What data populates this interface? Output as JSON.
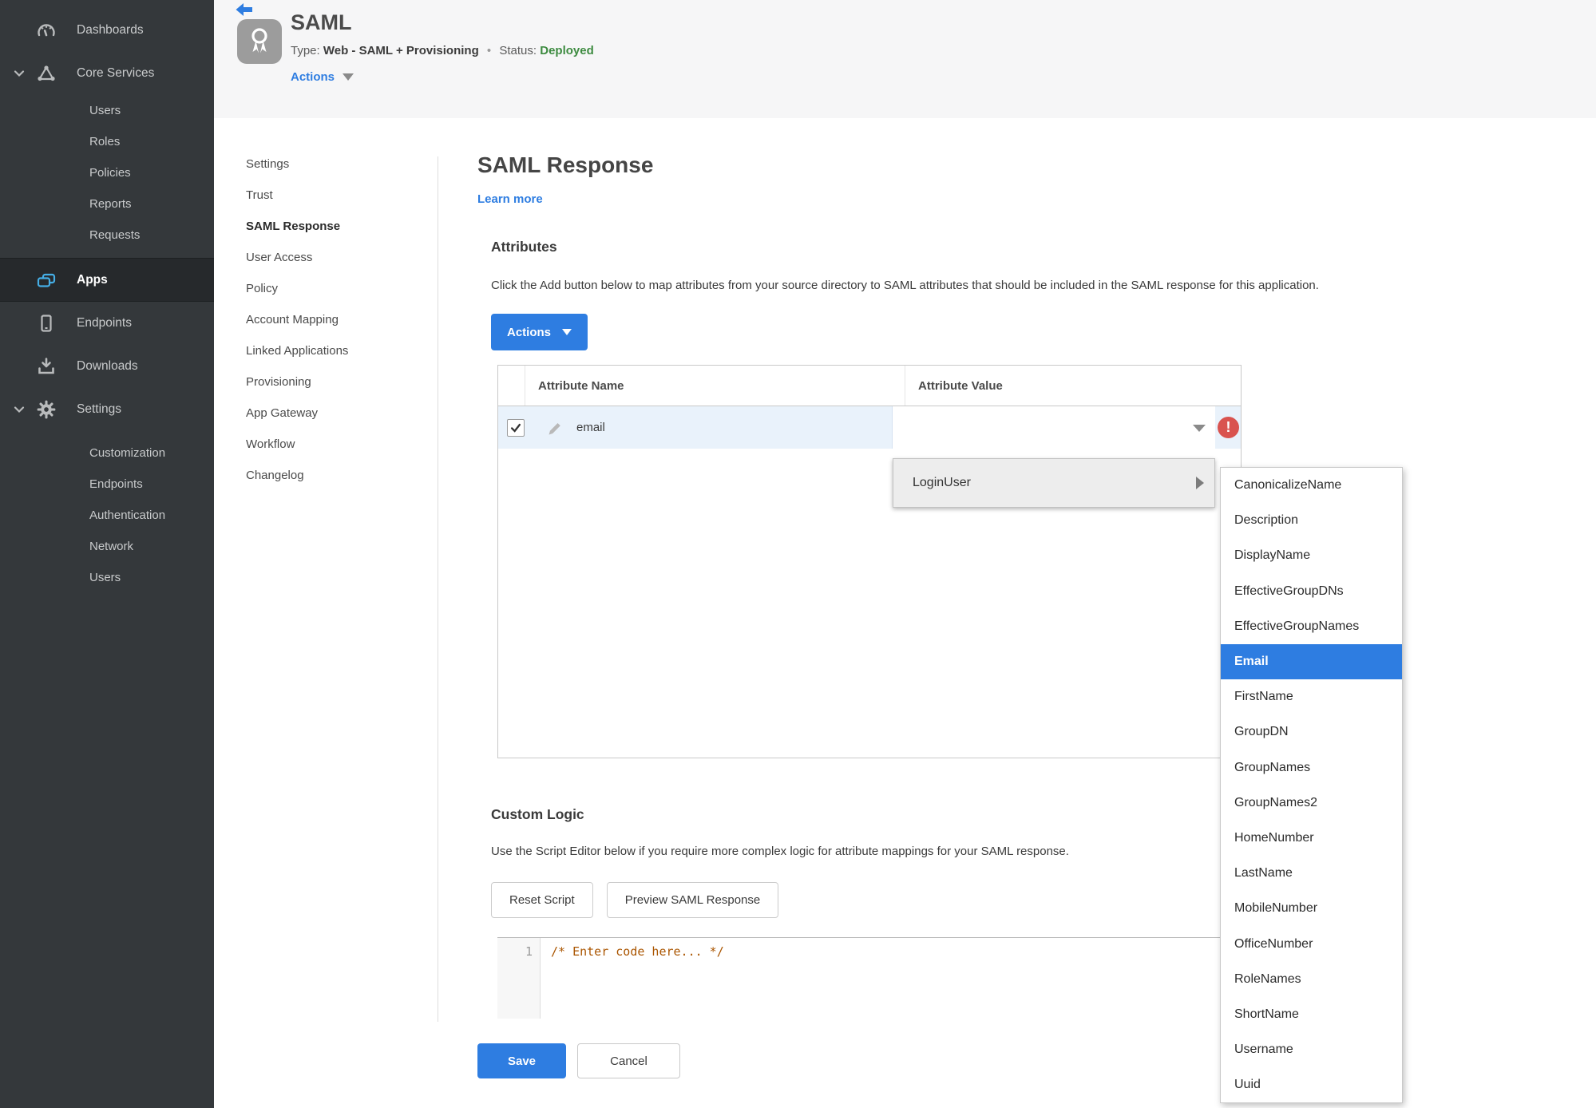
{
  "sidebar": {
    "items": [
      {
        "label": "Dashboards"
      },
      {
        "label": "Core Services"
      },
      {
        "label": "Users"
      },
      {
        "label": "Roles"
      },
      {
        "label": "Policies"
      },
      {
        "label": "Reports"
      },
      {
        "label": "Requests"
      },
      {
        "label": "Apps"
      },
      {
        "label": "Endpoints"
      },
      {
        "label": "Downloads"
      },
      {
        "label": "Settings"
      },
      {
        "label": "Customization"
      },
      {
        "label": "Endpoints"
      },
      {
        "label": "Authentication"
      },
      {
        "label": "Network"
      },
      {
        "label": "Users"
      }
    ],
    "active_item": "Apps"
  },
  "header": {
    "title": "SAML",
    "type_label": "Type:",
    "type_value": "Web - SAML + Provisioning",
    "separator": "•",
    "status_label": "Status:",
    "status_value": "Deployed",
    "actions_label": "Actions"
  },
  "subnav": {
    "items": [
      "Settings",
      "Trust",
      "SAML Response",
      "User Access",
      "Policy",
      "Account Mapping",
      "Linked Applications",
      "Provisioning",
      "App Gateway",
      "Workflow",
      "Changelog"
    ],
    "active_item": "SAML Response"
  },
  "main": {
    "page_title": "SAML Response",
    "learn_more": "Learn more",
    "attributes": {
      "heading": "Attributes",
      "description": "Click the Add button below to map attributes from your source directory to SAML attributes that should be included in the SAML response for this application.",
      "actions_button": "Actions",
      "table": {
        "columns": [
          "Attribute Name",
          "Attribute Value"
        ],
        "rows": [
          {
            "name": "email",
            "value": "",
            "checked": true,
            "has_error": true
          }
        ]
      }
    },
    "custom_logic": {
      "heading": "Custom Logic",
      "description": "Use the Script Editor below if you require more complex logic for attribute mappings for your SAML response.",
      "reset_button": "Reset Script",
      "preview_button": "Preview SAML Response",
      "editor": {
        "line_number": "1",
        "code": "/* Enter code here... */"
      }
    },
    "save_button": "Save",
    "cancel_button": "Cancel"
  },
  "dropdown": {
    "parent_item": "LoginUser",
    "submenu_items": [
      "CanonicalizeName",
      "Description",
      "DisplayName",
      "EffectiveGroupDNs",
      "EffectiveGroupNames",
      "Email",
      "FirstName",
      "GroupDN",
      "GroupNames",
      "GroupNames2",
      "HomeNumber",
      "LastName",
      "MobileNumber",
      "OfficeNumber",
      "RoleNames",
      "ShortName",
      "Username",
      "Uuid"
    ],
    "selected_item": "Email"
  },
  "colors": {
    "accent_blue": "#2e7de1",
    "status_green": "#3d8b40",
    "error_red": "#d9534f",
    "sidebar_bg": "#34383b",
    "selected_row_blue": "#e9f2fb"
  }
}
